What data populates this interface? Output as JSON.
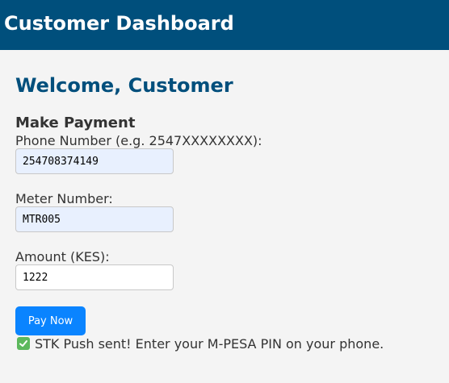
{
  "header": {
    "title": "Customer Dashboard",
    "background": "#004f7c"
  },
  "welcome": "Welcome, Customer",
  "payment_form": {
    "title": "Make Payment",
    "phone": {
      "label": "Phone Number (e.g. 2547XXXXXXXX):",
      "value": "254708374149"
    },
    "meter": {
      "label": "Meter Number:",
      "value": "MTR005"
    },
    "amount": {
      "label": "Amount (KES):",
      "value": "1222"
    },
    "submit_label": "Pay Now",
    "accent": "#0a84ff"
  },
  "status": {
    "icon": "check-mark-icon",
    "message": "STK Push sent! Enter your M-PESA PIN on your phone.",
    "color": "#5cb85c"
  }
}
